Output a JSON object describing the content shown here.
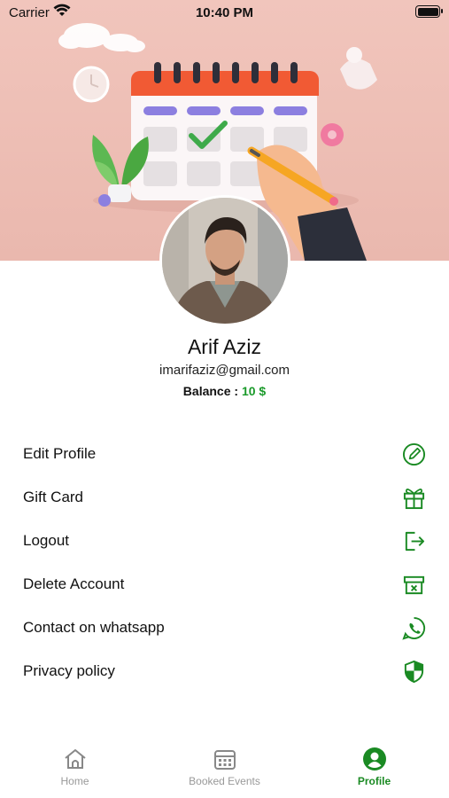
{
  "status_bar": {
    "carrier": "Carrier",
    "time": "10:40 PM"
  },
  "profile": {
    "name": "Arif Aziz",
    "email": "imarifaziz@gmail.com",
    "balance_label": "Balance :",
    "balance_value": "10 $"
  },
  "menu": {
    "items": [
      {
        "label": "Edit Profile",
        "icon": "edit-icon"
      },
      {
        "label": "Gift Card",
        "icon": "gift-icon"
      },
      {
        "label": "Logout",
        "icon": "logout-icon"
      },
      {
        "label": "Delete Account",
        "icon": "delete-archive-icon"
      },
      {
        "label": "Contact on whatsapp",
        "icon": "whatsapp-icon"
      },
      {
        "label": "Privacy policy",
        "icon": "shield-icon"
      }
    ]
  },
  "tabs": [
    {
      "label": "Home",
      "icon": "home-icon"
    },
    {
      "label": "Booked Events",
      "icon": "calendar-icon"
    },
    {
      "label": "Profile",
      "icon": "user-icon",
      "active": true
    }
  ],
  "colors": {
    "accent": "#1a8a23",
    "balance": "#1a9a2a",
    "banner": "#f1c5bc",
    "inactive_tab": "#999999"
  }
}
